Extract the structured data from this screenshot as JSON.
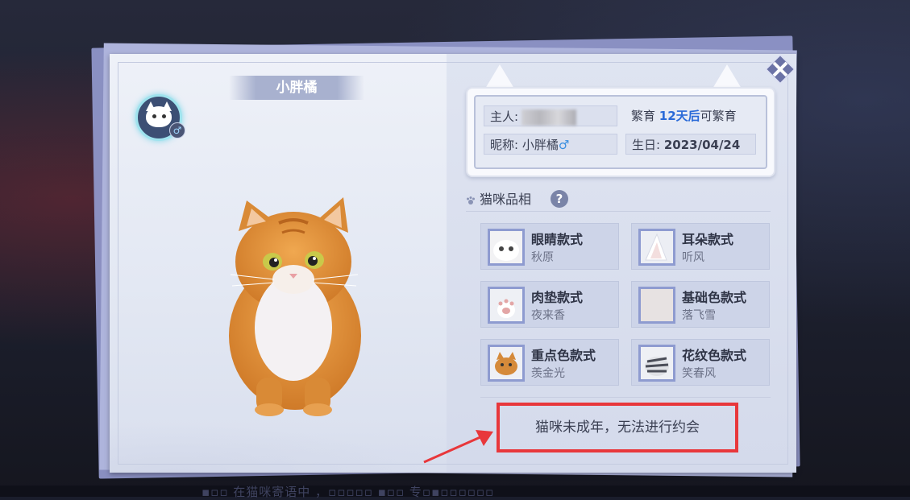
{
  "background": {
    "bottom_text": "▪▫▫ 在猫咪寄语中 ，▫▫▫▫▫ ▪▫▫ 专▫▪▫▫▫▫▫▫"
  },
  "cat": {
    "name": "小胖橘",
    "gender_symbol": "♂"
  },
  "info": {
    "owner_label": "主人:",
    "breed_label": "繁育",
    "breed_days": "12天后",
    "breed_suffix": "可繁育",
    "nickname_label": "昵称:",
    "nickname_value": "小胖橘",
    "gender_symbol": "♂",
    "birthday_label": "生日:",
    "birthday_value": "2023/04/24"
  },
  "traits_section": {
    "title": "猫咪品相",
    "help": "?"
  },
  "traits": [
    {
      "title": "眼睛款式",
      "value": "秋原"
    },
    {
      "title": "耳朵款式",
      "value": "听风"
    },
    {
      "title": "肉垫款式",
      "value": "夜来香"
    },
    {
      "title": "基础色款式",
      "value": "落飞雪"
    },
    {
      "title": "重点色款式",
      "value": "羡金光"
    },
    {
      "title": "花纹色款式",
      "value": "笑春风"
    }
  ],
  "date_notice": "猫咪未成年，无法进行约会",
  "colors": {
    "highlight_box": "#e8373b",
    "arrow": "#e8373b",
    "accent_blue": "#2a6ad8"
  },
  "icons": [
    "close-icon",
    "paw-icon",
    "help-icon",
    "male-icon",
    "cat-avatar-icon"
  ]
}
